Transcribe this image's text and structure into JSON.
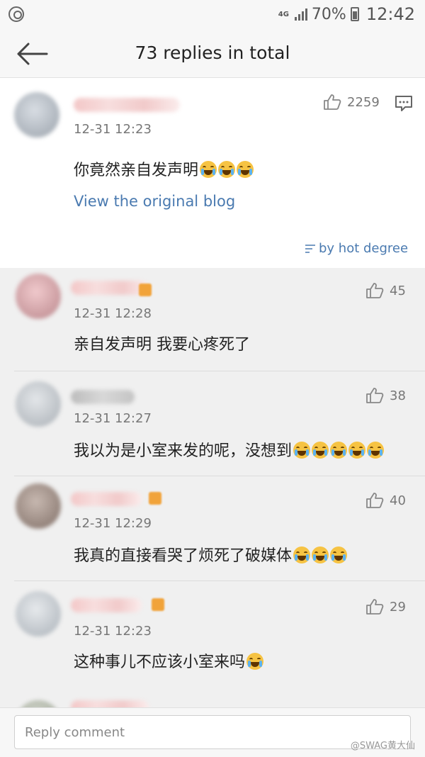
{
  "status_bar": {
    "network": "4G",
    "battery": "70%",
    "time": "12:42"
  },
  "header": {
    "title": "73 replies in total"
  },
  "main_post": {
    "timestamp": "12-31 12:23",
    "text": "你竟然亲自发声明",
    "emoji_count": 3,
    "likes": "2259",
    "view_original_label": "View the original blog",
    "sort_label": "by hot degree"
  },
  "replies": [
    {
      "timestamp": "12-31 12:28",
      "text": "亲自发声明 我要心疼死了",
      "emoji_count": 0,
      "likes": "45"
    },
    {
      "timestamp": "12-31 12:27",
      "text": "我以为是小室来发的呢，没想到",
      "emoji_count": 5,
      "likes": "38"
    },
    {
      "timestamp": "12-31 12:29",
      "text": "我真的直接看哭了烦死了破媒体",
      "emoji_count": 3,
      "likes": "40"
    },
    {
      "timestamp": "12-31 12:23",
      "text": "这种事儿不应该小室来吗",
      "emoji_count": 1,
      "likes": "29"
    }
  ],
  "reply_bar": {
    "placeholder": "Reply comment",
    "watermark": "@SWAG黄大仙"
  },
  "colors": {
    "link": "#4a7ab0",
    "timestamp": "#777777",
    "background": "#f0f0f0"
  }
}
